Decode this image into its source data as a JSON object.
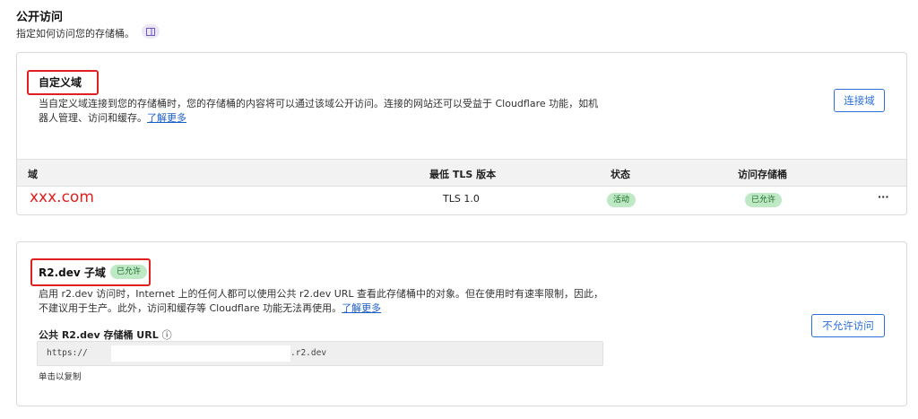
{
  "header": {
    "title": "公开访问",
    "description": "指定如何访问您的存储桶。",
    "icon": "document-icon"
  },
  "custom_domain": {
    "title": "自定义域",
    "description_line1": "当自定义域连接到您的存储桶时，您的存储桶的内容将可以通过该域公开访问。连接的网站还可以受益于 Cloudflare 功能，如机",
    "description_line2": "器人管理、访问和缓存。",
    "learn_more": "了解更多",
    "connect_button": "连接域",
    "table": {
      "columns": [
        "域",
        "最低 TLS 版本",
        "状态",
        "访问存储桶"
      ],
      "rows": [
        {
          "domain": "xxx.com",
          "tls": "TLS 1.0",
          "status": "活动",
          "access": "已允许",
          "menu": "···"
        }
      ]
    }
  },
  "r2dev": {
    "title": "R2.dev 子域",
    "badge": "已允许",
    "description_line1": "启用 r2.dev 访问时，Internet 上的任何人都可以使用公共 r2.dev URL 查看此存储桶中的对象。但在使用时有速率限制，因此，",
    "description_line2": "不建议用于生产。此外，访问和缓存等 Cloudflare 功能无法再使用。",
    "learn_more": "了解更多",
    "disallow_button": "不允许访问",
    "url_label": "公共 R2.dev 存储桶 URL",
    "url_prefix": "https://",
    "url_suffix": ".r2.dev",
    "copy_hint": "单击以复制"
  },
  "colors": {
    "accent": "#2b6fd6",
    "highlight": "#e02020",
    "badge_bg": "#bfe8c5",
    "badge_text": "#1c6b2a"
  }
}
